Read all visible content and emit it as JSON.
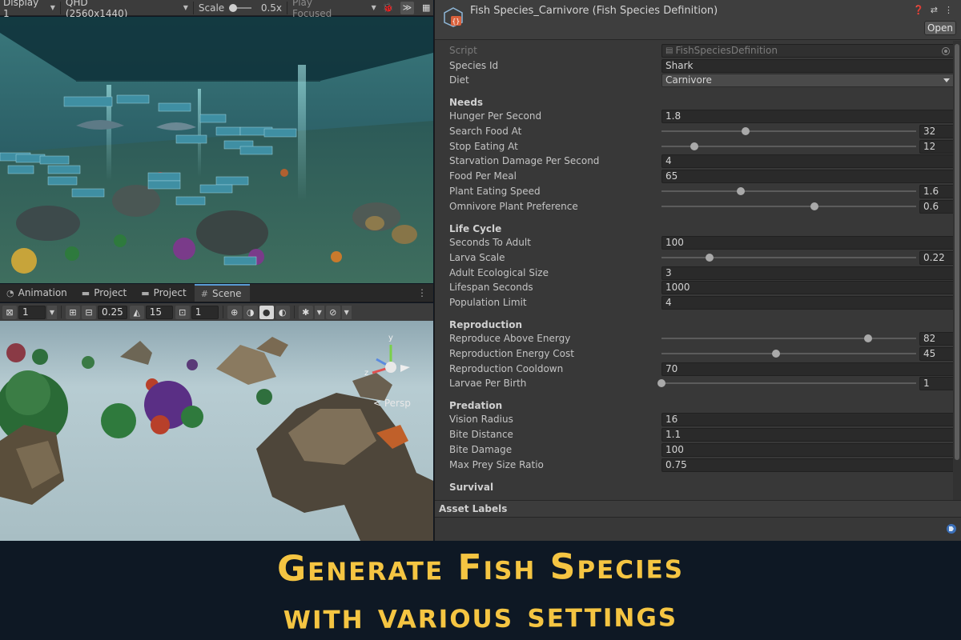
{
  "game_toolbar": {
    "display": "Display 1",
    "resolution": "QHD (2560x1440)",
    "scale_label": "Scale",
    "scale_value": "0.5x",
    "play_mode": "Play Focused"
  },
  "scene_tabs": [
    {
      "label": "Animation"
    },
    {
      "label": "Project"
    },
    {
      "label": "Project"
    },
    {
      "label": "Scene"
    }
  ],
  "scene_toolbar": {
    "grid_value": "1",
    "snap_value": "0.25",
    "rotate_value": "15",
    "scale_value": "1"
  },
  "scene_view": {
    "persp_label": "< Persp"
  },
  "inspector": {
    "title": "Fish Species_Carnivore (Fish Species Definition)",
    "open_button": "Open",
    "script_label": "Script",
    "script_value": "FishSpeciesDefinition",
    "species_id_label": "Species Id",
    "species_id_value": "Shark",
    "diet_label": "Diet",
    "diet_value": "Carnivore",
    "sections": {
      "needs": "Needs",
      "life_cycle": "Life Cycle",
      "reproduction": "Reproduction",
      "predation": "Predation",
      "survival": "Survival"
    },
    "fields": {
      "hunger_per_second": {
        "label": "Hunger Per Second",
        "value": "1.8"
      },
      "search_food_at": {
        "label": "Search Food At",
        "value": "32",
        "fraction": 0.33
      },
      "stop_eating_at": {
        "label": "Stop Eating At",
        "value": "12",
        "fraction": 0.13
      },
      "starvation_damage": {
        "label": "Starvation Damage Per Second",
        "value": "4"
      },
      "food_per_meal": {
        "label": "Food Per Meal",
        "value": "65"
      },
      "plant_eating_speed": {
        "label": "Plant Eating Speed",
        "value": "1.6",
        "fraction": 0.31
      },
      "omnivore_plant_pref": {
        "label": "Omnivore Plant Preference",
        "value": "0.6",
        "fraction": 0.6
      },
      "seconds_to_adult": {
        "label": "Seconds To Adult",
        "value": "100"
      },
      "larva_scale": {
        "label": "Larva Scale",
        "value": "0.22",
        "fraction": 0.19
      },
      "adult_ecological_size": {
        "label": "Adult Ecological Size",
        "value": "3"
      },
      "lifespan_seconds": {
        "label": "Lifespan Seconds",
        "value": "1000"
      },
      "population_limit": {
        "label": "Population Limit",
        "value": "4"
      },
      "reproduce_above_energy": {
        "label": "Reproduce Above Energy",
        "value": "82",
        "fraction": 0.81
      },
      "reproduction_energy_cost": {
        "label": "Reproduction Energy Cost",
        "value": "45",
        "fraction": 0.45
      },
      "reproduction_cooldown": {
        "label": "Reproduction Cooldown",
        "value": "70"
      },
      "larvae_per_birth": {
        "label": "Larvae Per Birth",
        "value": "1",
        "fraction": 0.0
      },
      "vision_radius": {
        "label": "Vision Radius",
        "value": "16"
      },
      "bite_distance": {
        "label": "Bite Distance",
        "value": "1.1"
      },
      "bite_damage": {
        "label": "Bite Damage",
        "value": "100"
      },
      "max_prey_size_ratio": {
        "label": "Max Prey Size Ratio",
        "value": "0.75"
      }
    },
    "asset_labels": "Asset Labels"
  },
  "banner": {
    "line1": "Generate Fish Species",
    "line2": "with various settings"
  },
  "colors": {
    "banner_text": "#f5c542",
    "banner_bg": "#0e1824",
    "inspector_bg": "#383838",
    "accent": "#5a9bd5"
  },
  "icons": [
    "display-dropdown-icon",
    "bug-icon",
    "stats-icon",
    "gizmos-icon",
    "scriptable-object-icon",
    "help-icon",
    "settings-icon",
    "more-icon",
    "target-icon",
    "tag-icon",
    "grid-icon",
    "snap-icon",
    "rotate-snap-icon",
    "scale-snap-icon",
    "shading-icon",
    "orientation-gizmo-icon"
  ]
}
